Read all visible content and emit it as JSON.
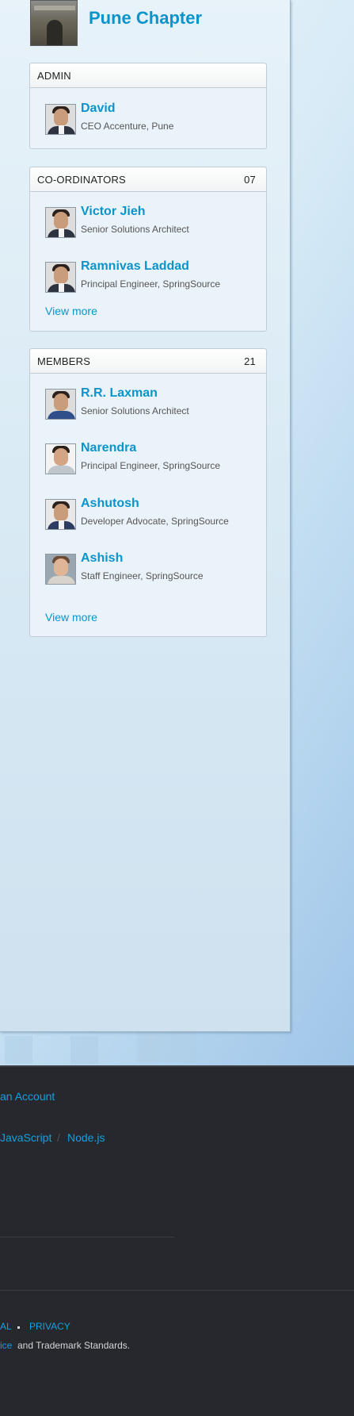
{
  "chapter": {
    "name": "Pune Chapter"
  },
  "admin": {
    "heading": "ADMIN",
    "people": [
      {
        "name": "David",
        "role": "CEO Accenture, Pune"
      }
    ]
  },
  "coordinators": {
    "heading": "CO-ORDINATORS",
    "count": "07",
    "people": [
      {
        "name": "Victor Jieh",
        "role": "Senior Solutions Architect"
      },
      {
        "name": "Ramnivas Laddad",
        "role": "Principal Engineer, SpringSource"
      }
    ],
    "view_more": "View more"
  },
  "members": {
    "heading": "MEMBERS",
    "count": "21",
    "people": [
      {
        "name": "R.R. Laxman",
        "role": "Senior Solutions Architect"
      },
      {
        "name": "Narendra",
        "role": "Principal Engineer, SpringSource"
      },
      {
        "name": "Ashutosh",
        "role": "Developer Advocate, SpringSource"
      },
      {
        "name": "Ashish",
        "role": "Staff Engineer, SpringSource"
      }
    ],
    "view_more": "View more"
  },
  "footer": {
    "account_link": "an Account",
    "javascript_link": "JavaScript",
    "separator": "/",
    "nodejs_link": "Node.js",
    "legal_link": "AL",
    "privacy_link": "PRIVACY",
    "service_link": "ice",
    "trademark_text": "and Trademark Standards."
  },
  "colors": {
    "accent": "#0a94cc",
    "footer_bg": "#26282d",
    "footer_link": "#12a1e0"
  }
}
